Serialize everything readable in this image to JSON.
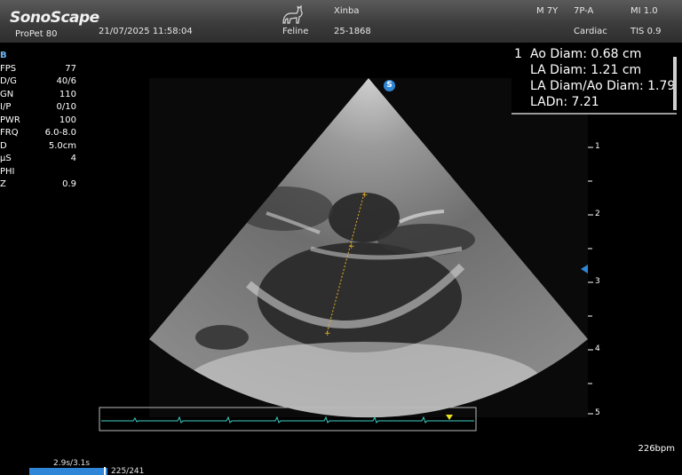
{
  "header": {
    "brand": "SonoScape",
    "model": "ProPet 80",
    "datetime": "21/07/2025 11:58:04",
    "species": "Feline",
    "patient_name": "Xinba",
    "patient_id": "25-1868",
    "sex_age": "M 7Y",
    "probe": "7P-A",
    "preset": "Cardiac",
    "mi": "MI 1.0",
    "tis": "TIS 0.9",
    "icon": "cat-icon"
  },
  "params": {
    "mode": "B",
    "rows": [
      {
        "k": "FPS",
        "v": "77"
      },
      {
        "k": "D/G",
        "v": "40/6"
      },
      {
        "k": "GN",
        "v": "110"
      },
      {
        "k": "I/P",
        "v": "0/10"
      },
      {
        "k": "PWR",
        "v": "100"
      },
      {
        "k": "FRQ",
        "v": "6.0-8.0"
      },
      {
        "k": "D",
        "v": "5.0cm"
      },
      {
        "k": "µS",
        "v": "4"
      },
      {
        "k": "PHI",
        "v": ""
      },
      {
        "k": "Z",
        "v": "0.9"
      }
    ]
  },
  "measurements": {
    "index": "1",
    "ao_diam": "Ao Diam: 0.68   cm",
    "la_diam": "LA Diam: 1.21   cm",
    "ratio": "LA Diam/Ao Diam: 1.79",
    "ladn": "LADn: 7.21"
  },
  "depth_scale": [
    "1",
    "2",
    "3",
    "4",
    "5"
  ],
  "heart_rate": "226bpm",
  "cine": {
    "time": "2.9s/3.1s",
    "frames": "225/241",
    "progress": 0.934
  },
  "colors": {
    "accent": "#2f86d6",
    "ecg": "#3fd0c8",
    "caliper": "#e8b020",
    "marker": "#e8e020"
  }
}
